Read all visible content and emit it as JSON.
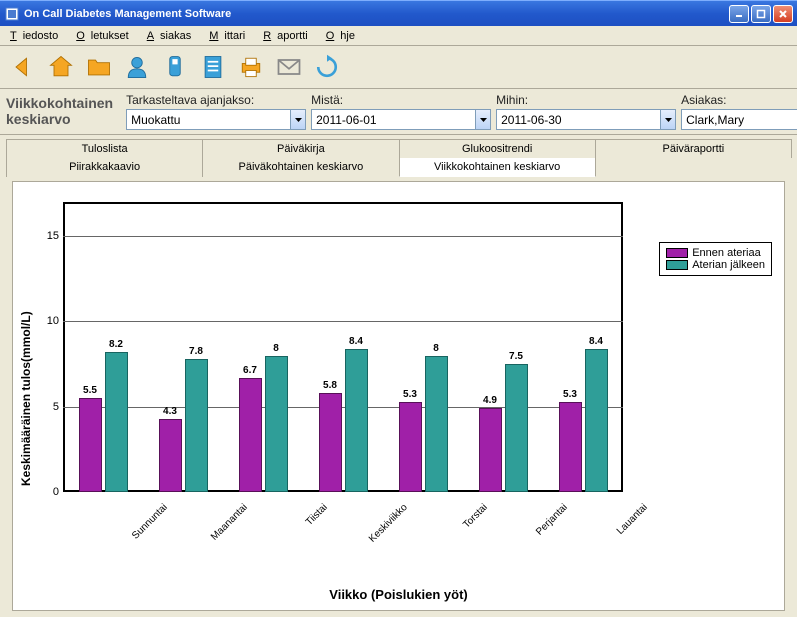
{
  "window": {
    "title": "On Call Diabetes Management Software"
  },
  "menu": {
    "file": "Tiedosto",
    "defaults": "Oletukset",
    "customer": "Asiakas",
    "meter": "Mittari",
    "report": "Raportti",
    "help": "Ohje"
  },
  "page_title": "Viikkokohtainen keskiarvo",
  "filters": {
    "range_label": "Tarkasteltava ajanjakso:",
    "range_value": "Muokattu",
    "from_label": "Mistä:",
    "from_value": "2011-06-01",
    "to_label": "Mihin:",
    "to_value": "2011-06-30",
    "customer_label": "Asiakas:",
    "customer_value": "Clark,Mary"
  },
  "tabs_row1": [
    "Tuloslista",
    "Päiväkirja",
    "Glukoositrendi",
    "Päiväraportti"
  ],
  "tabs_row2": [
    "Piirakkakaavio",
    "Päiväkohtainen keskiarvo",
    "Viikkokohtainen keskiarvo"
  ],
  "active_tab": "Viikkokohtainen keskiarvo",
  "legend": {
    "pre": "Ennen ateriaa",
    "post": "Aterian jälkeen"
  },
  "chart_data": {
    "type": "bar",
    "title": "",
    "xlabel": "Viikko (Poislukien yöt)",
    "ylabel": "Keskimääräinen tulos(mmol/L)",
    "ylim": [
      0,
      17
    ],
    "yticks": [
      0,
      5,
      10,
      15
    ],
    "categories": [
      "Sunnuntai",
      "Maanantai",
      "Tiistai",
      "Keskiviikko",
      "Torstai",
      "Perjantai",
      "Lauantai"
    ],
    "series": [
      {
        "name": "Ennen ateriaa",
        "color": "#a020a8",
        "values": [
          5.5,
          4.3,
          6.7,
          5.8,
          5.3,
          4.9,
          5.3
        ]
      },
      {
        "name": "Aterian jälkeen",
        "color": "#2f9e98",
        "values": [
          8.2,
          7.8,
          8.0,
          8.4,
          8.0,
          7.5,
          8.4
        ]
      }
    ]
  }
}
